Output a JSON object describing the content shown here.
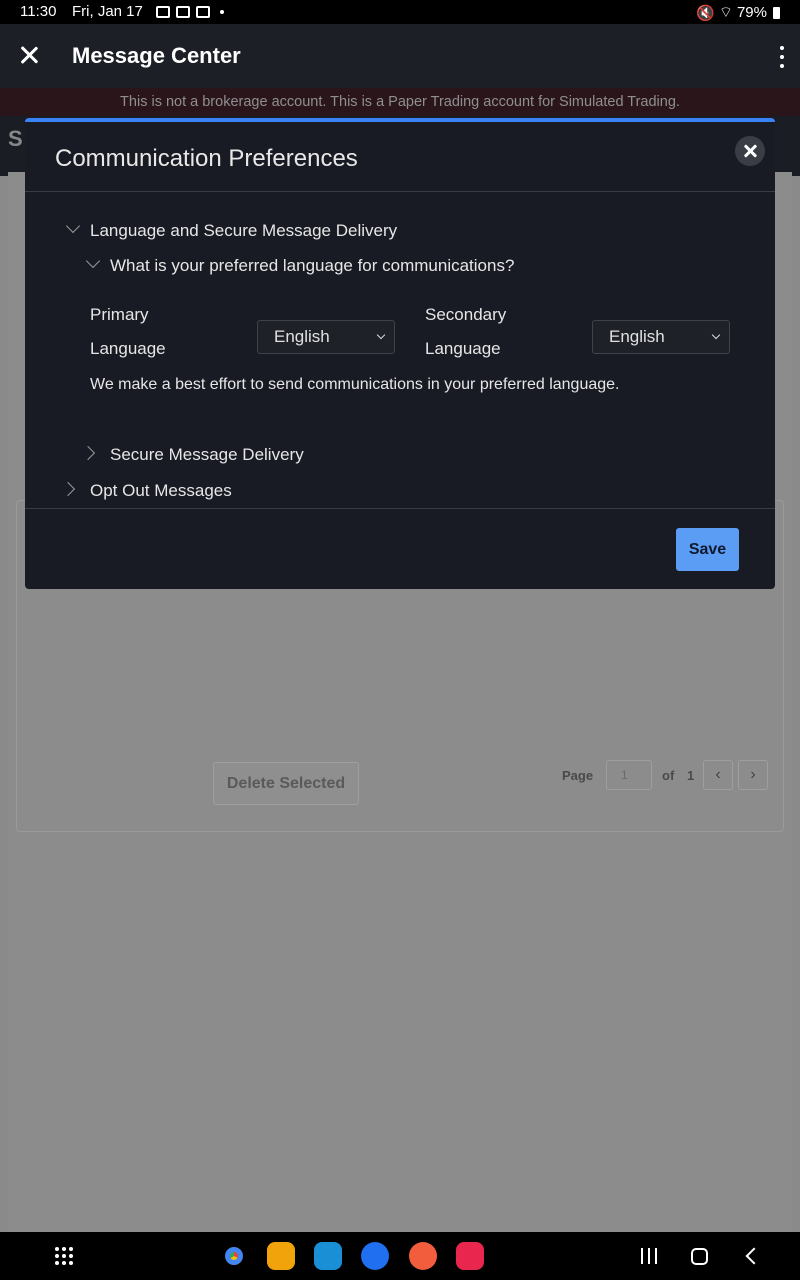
{
  "status_bar": {
    "time": "11:30",
    "date": "Fri, Jan 17",
    "battery": "79%"
  },
  "app_bar": {
    "title": "Message Center"
  },
  "banner": {
    "text": "This is not a brokerage account. This is a Paper Trading account for Simulated Trading."
  },
  "background": {
    "section_initial": "S",
    "delete_label": "Delete Selected",
    "page_label": "Page",
    "page_value": "1",
    "of_label": "of",
    "total_pages": "1",
    "prev_icon": "chevron-left-icon",
    "next_icon": "chevron-right-icon"
  },
  "modal": {
    "title": "Communication Preferences",
    "section_language": "Language and Secure Message Delivery",
    "question": "What is your preferred language for communications?",
    "primary_label_1": "Primary",
    "primary_label_2": "Language",
    "primary_value": "English",
    "secondary_label_1": "Secondary",
    "secondary_label_2": "Language",
    "secondary_value": "English",
    "note": "We make a best effort to send communications in your preferred language.",
    "secure_delivery": "Secure Message Delivery",
    "opt_out": "Opt Out Messages",
    "save_label": "Save"
  },
  "colors": {
    "accent": "#3b82f6",
    "save_button": "#5b9cf5",
    "modal_bg": "#191b24"
  },
  "nav_bar": {
    "apps": [
      "chrome-icon",
      "files-icon",
      "calendar-icon",
      "messages-icon",
      "contacts-icon",
      "camera-icon"
    ]
  }
}
